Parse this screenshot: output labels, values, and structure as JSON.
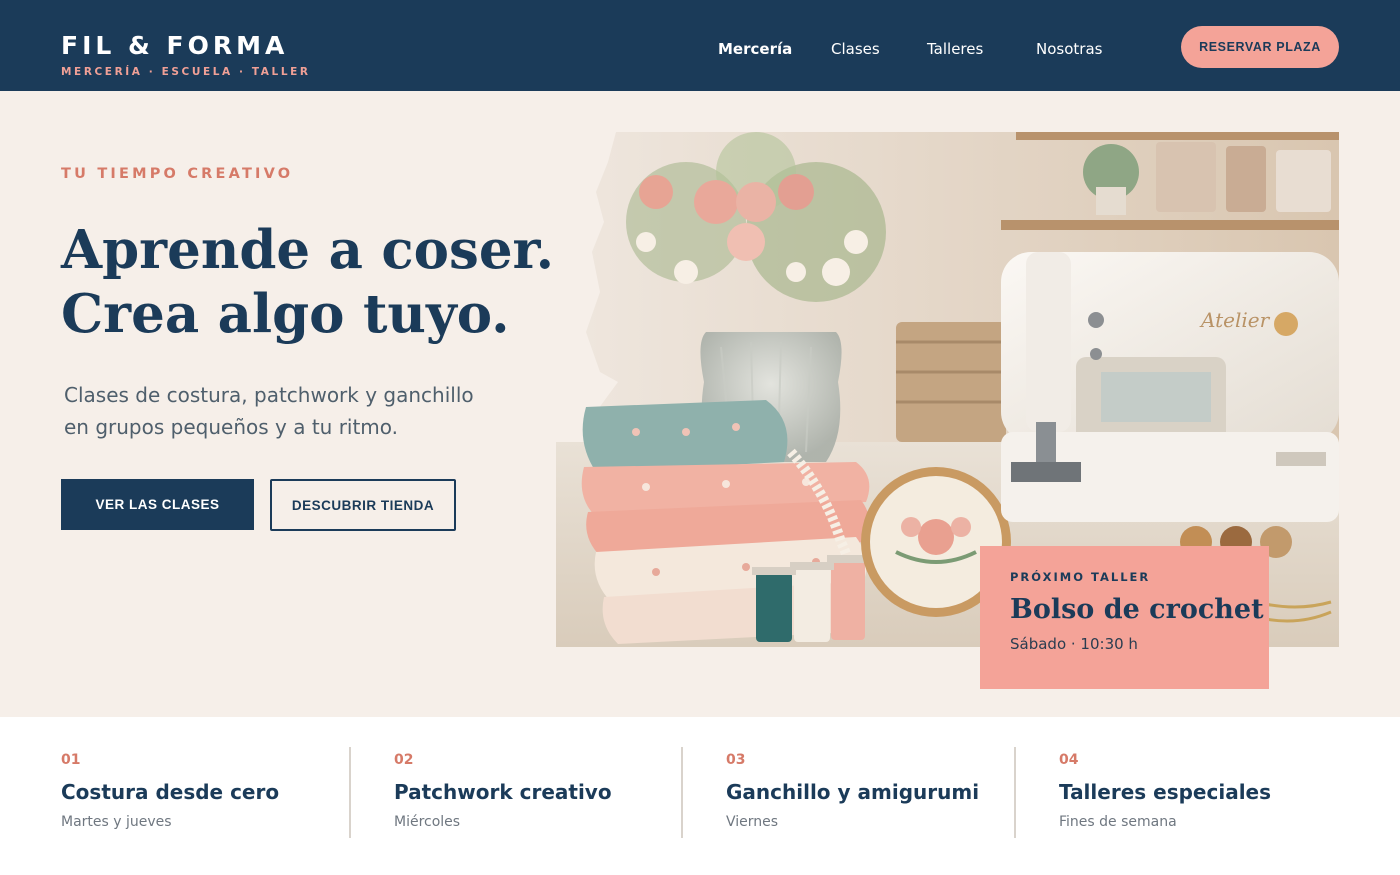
{
  "brand": {
    "name": "FIL & FORMA",
    "tagline": "MERCERÍA · ESCUELA · TALLER"
  },
  "nav": {
    "items": [
      {
        "label": "Mercería",
        "active": true
      },
      {
        "label": "Clases",
        "active": false
      },
      {
        "label": "Talleres",
        "active": false
      },
      {
        "label": "Nosotras",
        "active": false
      }
    ],
    "cta": "RESERVAR PLAZA"
  },
  "hero": {
    "eyebrow": "TU TIEMPO CREATIVO",
    "headline_line1": "Aprende a coser.",
    "headline_line2": "Crea algo tuyo.",
    "subtext_line1": "Clases de costura, patchwork y ganchillo",
    "subtext_line2": "en grupos pequeños y a tu ritmo.",
    "primary_button": "VER LAS CLASES",
    "secondary_button": "DESCUBRIR TIENDA"
  },
  "next_workshop": {
    "label": "PRÓXIMO TALLER",
    "title": "Bolso de crochet",
    "meta": "Sábado · 10:30 h"
  },
  "image": {
    "machine_brand": "Atelier"
  },
  "features": [
    {
      "number": "01",
      "title": "Costura desde cero",
      "schedule": "Martes y jueves"
    },
    {
      "number": "02",
      "title": "Patchwork creativo",
      "schedule": "Miércoles"
    },
    {
      "number": "03",
      "title": "Ganchillo y amigurumi",
      "schedule": "Viernes"
    },
    {
      "number": "04",
      "title": "Talleres especiales",
      "schedule": "Fines de semana"
    }
  ],
  "colors": {
    "navy": "#1b3b59",
    "coral": "#f4a398",
    "accent_text": "#d67a68",
    "background": "#f6efe9"
  }
}
